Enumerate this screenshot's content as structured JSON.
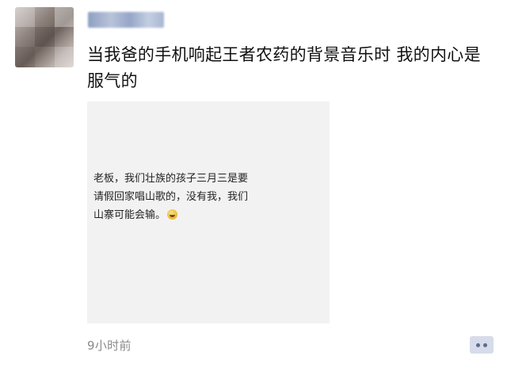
{
  "post": {
    "author_name": "",
    "text": "当我爸的手机响起王者农药的背景音乐时 我的内心是服气的",
    "timestamp": "9小时前"
  },
  "image": {
    "chat_text": "老板，我们壮族的孩子三月三是要请假回家唱山歌的，没有我，我们山寨可能会输。",
    "emoji_icon": "laughing-tears-emoji"
  },
  "actions": {
    "comment_icon": "comment-dots-icon"
  }
}
